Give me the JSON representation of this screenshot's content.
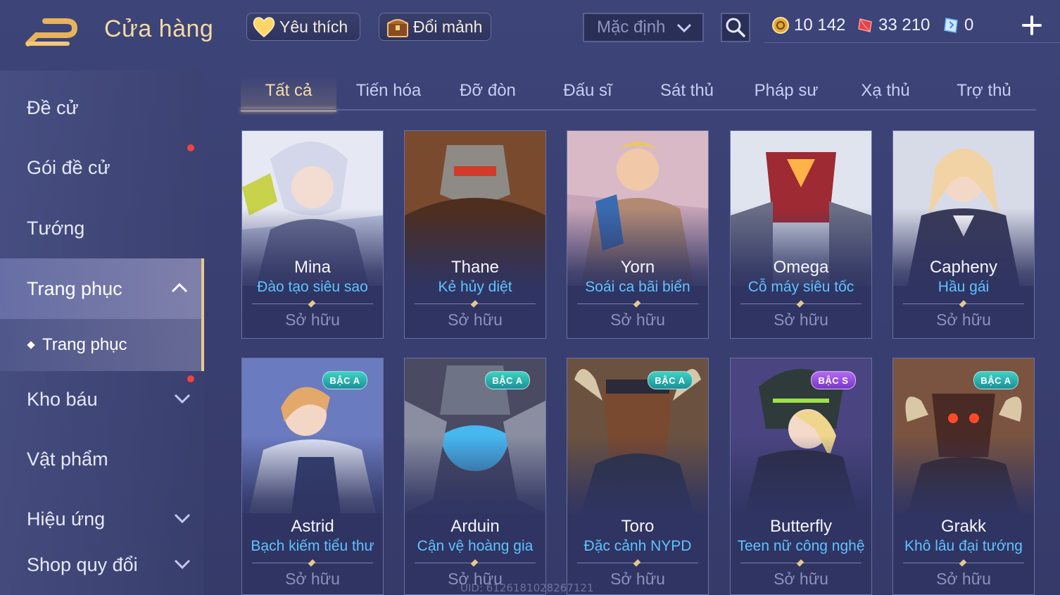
{
  "header": {
    "title": "Cửa hàng",
    "favorite_label": "Yêu thích",
    "shard_label": "Đổi mảnh",
    "sort_value": "Mặc định",
    "gold": "10 142",
    "vouchers": "33 210",
    "tickets": "0",
    "icons": [
      "back-arrow-icon",
      "heart-icon",
      "chest-icon",
      "chevron-down-icon",
      "search-icon",
      "gold-coin-icon",
      "voucher-gem-icon",
      "ticket-icon",
      "plus-icon"
    ]
  },
  "sidebar": {
    "items": [
      {
        "label": "Đề cử"
      },
      {
        "label": "Gói đề cử"
      },
      {
        "label": "Tướng"
      },
      {
        "label": "Trang phục"
      },
      {
        "label": "Kho báu"
      },
      {
        "label": "Vật phẩm"
      },
      {
        "label": "Hiệu ứng"
      },
      {
        "label": "Shop quy đổi"
      }
    ],
    "sub_item": "Trang phục"
  },
  "tabs": [
    "Tất cả",
    "Tiến hóa",
    "Đỡ đòn",
    "Đấu sĩ",
    "Sát thủ",
    "Pháp sư",
    "Xạ thủ",
    "Trợ thủ"
  ],
  "cards": [
    {
      "hero": "Mina",
      "skin": "Đào tạo siêu sao",
      "status": "Sở hữu",
      "badge": ""
    },
    {
      "hero": "Thane",
      "skin": "Kẻ hủy diệt",
      "status": "Sở hữu",
      "badge": ""
    },
    {
      "hero": "Yorn",
      "skin": "Soái ca bãi biển",
      "status": "Sở hữu",
      "badge": ""
    },
    {
      "hero": "Omega",
      "skin": "Cỗ máy siêu tốc",
      "status": "Sở hữu",
      "badge": ""
    },
    {
      "hero": "Capheny",
      "skin": "Hầu gái",
      "status": "Sở hữu",
      "badge": ""
    },
    {
      "hero": "Astrid",
      "skin": "Bạch kiếm tiểu thư",
      "status": "Sở hữu",
      "badge": "BẬC A"
    },
    {
      "hero": "Arduin",
      "skin": "Cận vệ hoàng gia",
      "status": "Sở hữu",
      "badge": "BẬC A"
    },
    {
      "hero": "Toro",
      "skin": "Đặc cảnh NYPD",
      "status": "Sở hữu",
      "badge": "BẬC A"
    },
    {
      "hero": "Butterfly",
      "skin": "Teen nữ công nghệ",
      "status": "Sở hữu",
      "badge": "BẬC S"
    },
    {
      "hero": "Grakk",
      "skin": "Khô lâu đại tướng",
      "status": "Sở hữu",
      "badge": "BẬC A"
    }
  ],
  "uid": "UID: 6126181028267121",
  "colors": {
    "accent": "#f0d39b",
    "skin_text": "#5fc3ff",
    "notify": "#f2433c",
    "badge_a": "#2bb4b0",
    "badge_s": "#9a50de"
  }
}
